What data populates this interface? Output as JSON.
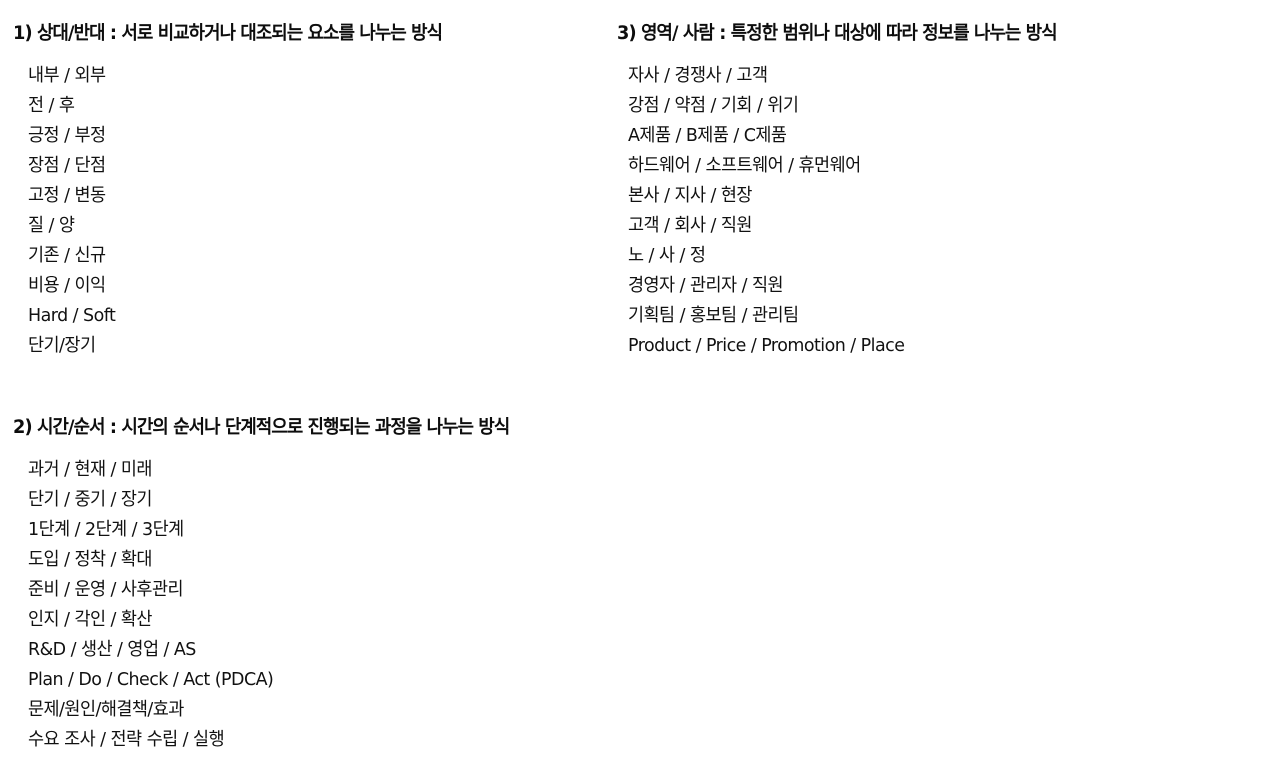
{
  "document": {
    "background_color": "#ffffff",
    "text_color": "#111111",
    "language": "ko"
  },
  "sections": [
    {
      "id": "section-1",
      "number": "1)",
      "heading": "1) 상대/반대 : 서로 비교하거나 대조되는 요소를 나누는 방식",
      "title": "상대/반대",
      "description": "서로 비교하거나 대조되는 요소를 나누는 방식",
      "items": [
        "내부 / 외부",
        "전 / 후",
        "긍정 / 부정",
        "장점 / 단점",
        "고정 / 변동",
        "질 / 양",
        "기존 / 신규",
        "비용 / 이익",
        "Hard / Soft",
        "단기/장기"
      ]
    },
    {
      "id": "section-2",
      "number": "2)",
      "heading": "2) 시간/순서 : 시간의 순서나 단계적으로 진행되는 과정을 나누는 방식",
      "title": "시간/순서",
      "description": "시간의 순서나 단계적으로 진행되는 과정을 나누는 방식",
      "items": [
        "과거 / 현재 / 미래",
        "단기 / 중기 / 장기",
        "1단계 / 2단계 / 3단계",
        "도입 / 정착 / 확대",
        "준비 / 운영 / 사후관리",
        "인지 / 각인 / 확산",
        "R&D / 생산 / 영업 / AS",
        "Plan / Do / Check / Act (PDCA)",
        "문제/원인/해결책/효과",
        "수요 조사 / 전략 수립 / 실행"
      ]
    },
    {
      "id": "section-3",
      "number": "3)",
      "heading": "3) 영역/ 사람 : 특정한 범위나 대상에 따라 정보를 나누는 방식",
      "title": "영역/ 사람",
      "description": "특정한 범위나 대상에 따라 정보를 나누는 방식",
      "items": [
        "자사 / 경쟁사 / 고객",
        "강점 / 약점 / 기회 / 위기",
        "A제품 / B제품 / C제품",
        "하드웨어 / 소프트웨어 / 휴먼웨어",
        "본사 / 지사 / 현장",
        "고객 / 회사 / 직원",
        "노 / 사 / 정",
        "경영자 / 관리자 / 직원",
        "기획팀 / 홍보팀 / 관리팀",
        "Product / Price / Promotion / Place"
      ]
    }
  ]
}
